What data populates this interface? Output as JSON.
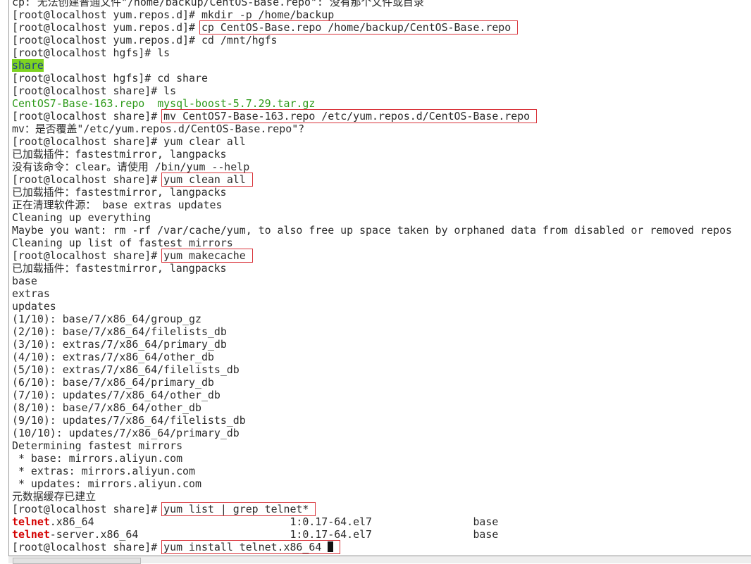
{
  "terminal": {
    "lines": [
      [
        {
          "t": "cp: 无法创建普通文件\"/home/backup/CentOS-Base.repo\": 没有那个文件或目录"
        }
      ],
      [
        {
          "t": "[root@localhost yum.repos.d]# mkdir -p /home/backup"
        }
      ],
      [
        {
          "t": "[root@localhost yum.repos.d]# "
        },
        {
          "t": "cp CentOS-Base.repo /home/backup/CentOS-Base.repo",
          "s": "box"
        }
      ],
      [
        {
          "t": "[root@localhost yum.repos.d]# cd /mnt/hgfs"
        }
      ],
      [
        {
          "t": "[root@localhost hgfs]# ls"
        }
      ],
      [
        {
          "t": "share",
          "s": "hl"
        }
      ],
      [
        {
          "t": "[root@localhost hgfs]# cd share"
        }
      ],
      [
        {
          "t": "[root@localhost share]# ls"
        }
      ],
      [
        {
          "t": "CentOS7-Base-163.repo  mysql-boost-5.7.29.tar.gz",
          "s": "green"
        }
      ],
      [
        {
          "t": "[root@localhost share]# "
        },
        {
          "t": "mv CentOS7-Base-163.repo /etc/yum.repos.d/CentOS-Base.repo",
          "s": "box"
        }
      ],
      [
        {
          "t": "mv：是否覆盖\"/etc/yum.repos.d/CentOS-Base.repo\"?"
        }
      ],
      [
        {
          "t": "[root@localhost share]# yum clear all"
        }
      ],
      [
        {
          "t": "已加载插件：fastestmirror, langpacks"
        }
      ],
      [
        {
          "t": "没有该命令：clear。请使用 /bin/yum --help"
        }
      ],
      [
        {
          "t": "[root@localhost share]# "
        },
        {
          "t": "yum clean all",
          "s": "box"
        }
      ],
      [
        {
          "t": "已加载插件：fastestmirror, langpacks"
        }
      ],
      [
        {
          "t": "正在清理软件源： base extras updates"
        }
      ],
      [
        {
          "t": "Cleaning up everything"
        }
      ],
      [
        {
          "t": "Maybe you want: rm -rf /var/cache/yum, to also free up space taken by orphaned data from disabled or removed repos"
        }
      ],
      [
        {
          "t": "Cleaning up list of fastest mirrors"
        }
      ],
      [
        {
          "t": "[root@localhost share]# "
        },
        {
          "t": "yum makecache",
          "s": "box"
        }
      ],
      [
        {
          "t": "已加载插件：fastestmirror, langpacks"
        }
      ],
      [
        {
          "t": "base"
        }
      ],
      [
        {
          "t": "extras"
        }
      ],
      [
        {
          "t": "updates"
        }
      ],
      [
        {
          "t": "(1/10): base/7/x86_64/group_gz"
        }
      ],
      [
        {
          "t": "(2/10): base/7/x86_64/filelists_db"
        }
      ],
      [
        {
          "t": "(3/10): extras/7/x86_64/primary_db"
        }
      ],
      [
        {
          "t": "(4/10): extras/7/x86_64/other_db"
        }
      ],
      [
        {
          "t": "(5/10): extras/7/x86_64/filelists_db"
        }
      ],
      [
        {
          "t": "(6/10): base/7/x86_64/primary_db"
        }
      ],
      [
        {
          "t": "(7/10): updates/7/x86_64/other_db"
        }
      ],
      [
        {
          "t": "(8/10): base/7/x86_64/other_db"
        }
      ],
      [
        {
          "t": "(9/10): updates/7/x86_64/filelists_db"
        }
      ],
      [
        {
          "t": "(10/10): updates/7/x86_64/primary_db"
        }
      ],
      [
        {
          "t": "Determining fastest mirrors"
        }
      ],
      [
        {
          "t": " * base: mirrors.aliyun.com"
        }
      ],
      [
        {
          "t": " * extras: mirrors.aliyun.com"
        }
      ],
      [
        {
          "t": " * updates: mirrors.aliyun.com"
        }
      ],
      [
        {
          "t": "元数据缓存已建立"
        }
      ],
      [
        {
          "t": "[root@localhost share]# "
        },
        {
          "t": "yum list | grep telnet*",
          "s": "box"
        }
      ],
      [
        {
          "t": "telnet",
          "s": "red"
        },
        {
          "t": ".x86_64                               1:0.17-64.el7                base"
        }
      ],
      [
        {
          "t": "telnet",
          "s": "red"
        },
        {
          "t": "-server.x86_64                        1:0.17-64.el7                base"
        }
      ],
      [
        {
          "t": "[root@localhost share]# "
        },
        {
          "t": "yum install telnet.x86_64 ",
          "s": "box",
          "cursor": true
        }
      ]
    ]
  },
  "colors": {
    "box": "#d9333a",
    "green": "#2e9a1a",
    "highlight": "#7ed321",
    "match": "#d40000"
  }
}
